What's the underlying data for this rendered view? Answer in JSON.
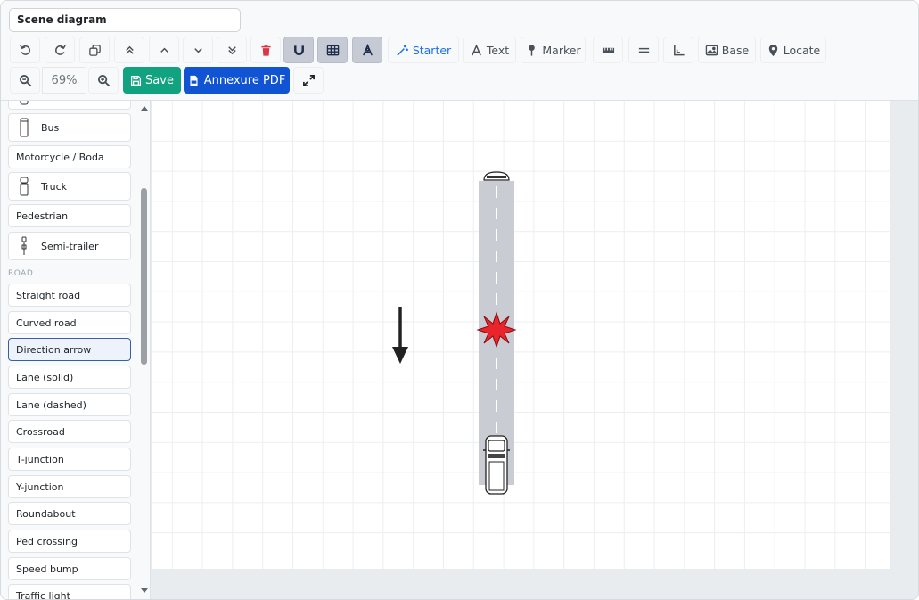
{
  "header": {
    "title": "Scene diagram"
  },
  "toolbar": {
    "starter_label": "Starter",
    "text_label": "Text",
    "marker_label": "Marker",
    "base_label": "Base",
    "locate_label": "Locate",
    "zoom_value": "69%",
    "save_label": "Save",
    "annexure_label": "Annexure PDF"
  },
  "sidebar": {
    "vehicles": [
      "Bus",
      "Motorcycle / Boda",
      "Truck",
      "Pedestrian",
      "Semi-trailer"
    ],
    "road_section": "ROAD",
    "road_items": [
      "Straight road",
      "Curved road",
      "Direction arrow",
      "Lane (solid)",
      "Lane (dashed)",
      "Crossroad",
      "T-junction",
      "Y-junction",
      "Roundabout",
      "Ped crossing",
      "Speed bump",
      "Traffic light"
    ],
    "selected_item": "Direction arrow"
  },
  "colors": {
    "save": "#11a37f",
    "annexure": "#1054d4",
    "starter": "#1a6ef5",
    "delete": "#dc3545",
    "road": "#c9ccd3",
    "impact": "#e8252b"
  }
}
